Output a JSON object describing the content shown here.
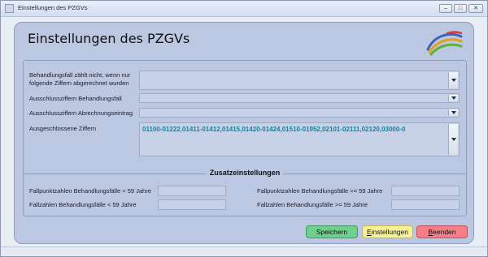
{
  "window": {
    "title": "Einstellungen des PZGVs"
  },
  "header": {
    "title": "Einstellungen des PZGVs"
  },
  "form": {
    "behandlungsfall_label": "Behandlungsfall zählt nicht, wenn nur folgende Ziffern abgerechnet wurden",
    "behandlungsfall_value": "",
    "ausschluss_behandlungsfall_label": "Ausschlussziffern Behandlungsfall",
    "ausschluss_behandlungsfall_value": "",
    "ausschluss_abrechnung_label": "Ausschlussziffern Abrechnungseintrag",
    "ausschluss_abrechnung_value": "",
    "ausgeschlossene_label": "Ausgeschlossene Ziffern",
    "ausgeschlossene_value": "01100-01222,01411-01412,01415,01420-01424,01510-01952,02101-02111,02120,03000-0"
  },
  "zusatz": {
    "title": "Zusatzeinstellungen",
    "fallpunkt_unter59_label": "Fallpunktzahlen Behandlungsfälle < 59 Jahre",
    "fallpunkt_ab59_label": "Fallpunktzahlen Behandlungsfälle >= 59 Jahre",
    "fallzahl_unter59_label": "Fallzahlen Behandlungsfälle < 59 Jahre",
    "fallzahl_ab59_label": "Fallzahlen Behandlungsfälle >= 59 Jahre",
    "fallpunkt_unter59_value": "",
    "fallpunkt_ab59_value": "",
    "fallzahl_unter59_value": "",
    "fallzahl_ab59_value": ""
  },
  "buttons": {
    "save": "Speichern",
    "settings_first": "E",
    "settings_rest": "instellungen",
    "quit_first": "B",
    "quit_rest": "eenden"
  },
  "colors": {
    "panel": "#bcc8e1",
    "field": "#c7d1e7",
    "ziffern_text": "#13849c",
    "save": "#6fcf8f",
    "settings": "#f7f299",
    "quit": "#f47f88"
  },
  "icons": [
    "app-icon",
    "minimize-icon",
    "maximize-icon",
    "close-icon",
    "dropdown-arrow-icon",
    "logo-swoosh"
  ]
}
